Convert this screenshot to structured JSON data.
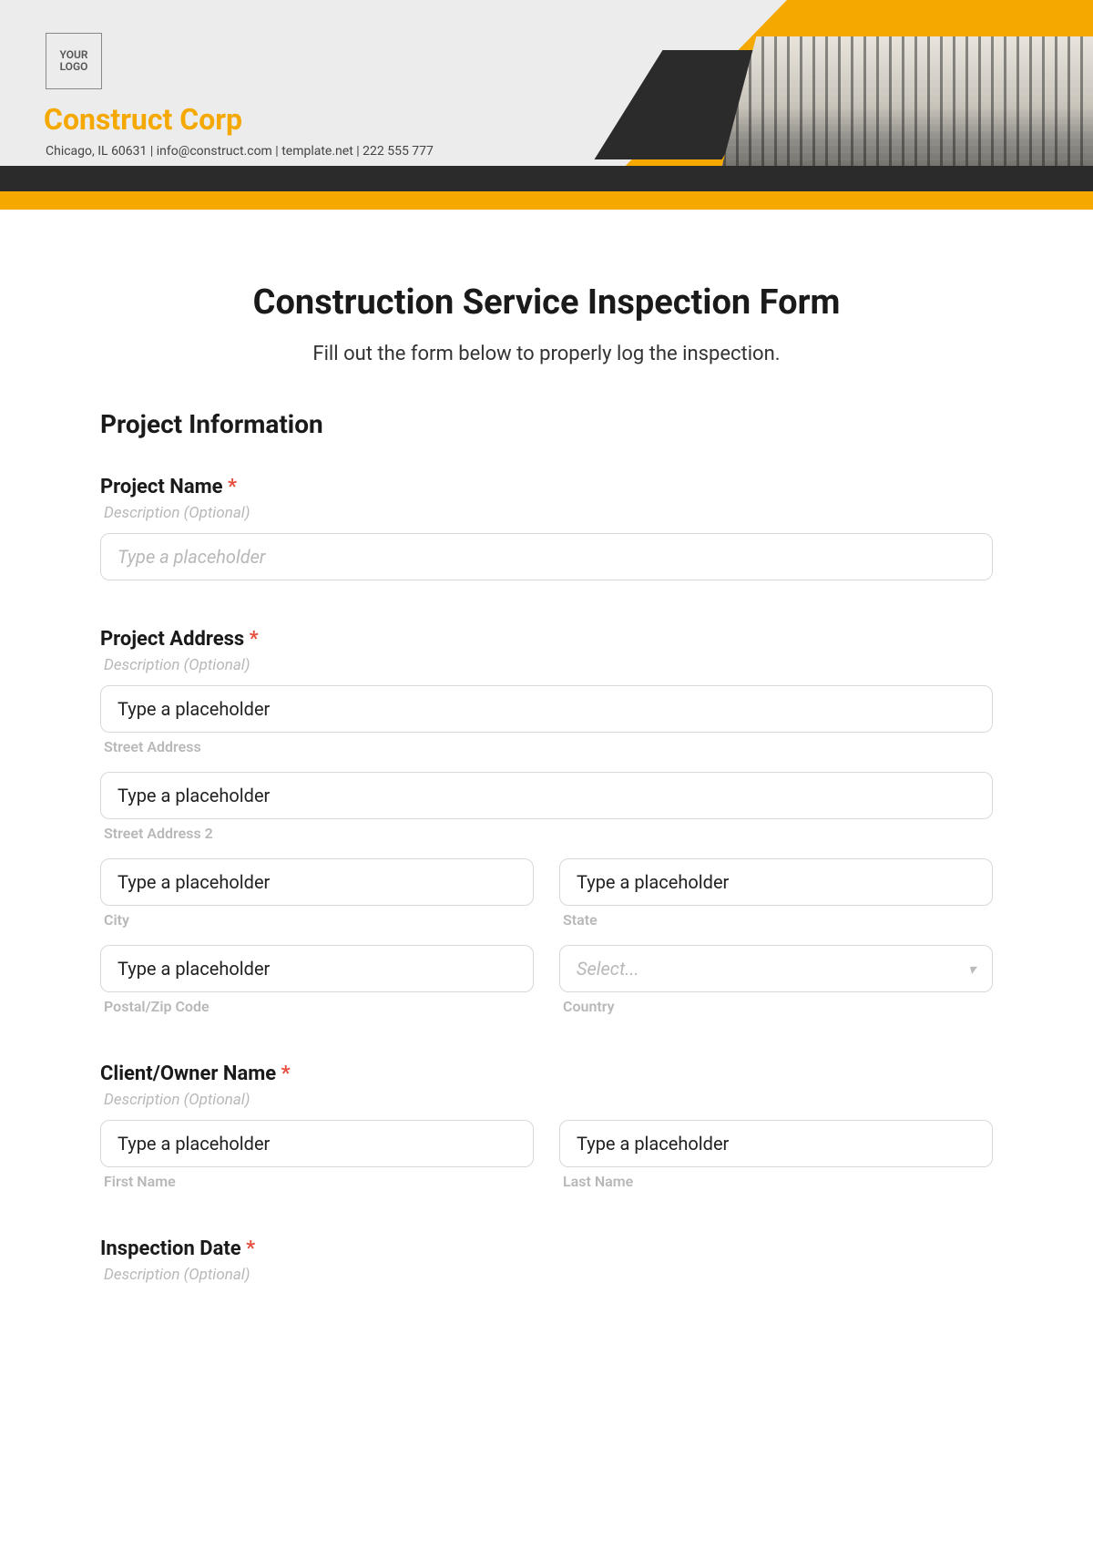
{
  "header": {
    "logo_text": "YOUR LOGO",
    "company_name": "Construct Corp",
    "company_info": "Chicago, IL 60631 | info@construct.com | template.net | 222 555 777"
  },
  "form": {
    "title": "Construction Service Inspection Form",
    "subtitle": "Fill out the form below to properly log the inspection.",
    "section_project_info": "Project Information",
    "required_mark": "*",
    "desc_optional": "Description (Optional)",
    "placeholder_italic": "Type a placeholder",
    "placeholder_plain": "Type a placeholder",
    "select_placeholder": "Select...",
    "fields": {
      "project_name": "Project Name",
      "project_address": "Project Address",
      "street_address": "Street Address",
      "street_address_2": "Street Address 2",
      "city": "City",
      "state": "State",
      "postal": "Postal/Zip Code",
      "country": "Country",
      "client_owner": "Client/Owner Name",
      "first_name": "First Name",
      "last_name": "Last Name",
      "inspection_date": "Inspection Date"
    }
  }
}
